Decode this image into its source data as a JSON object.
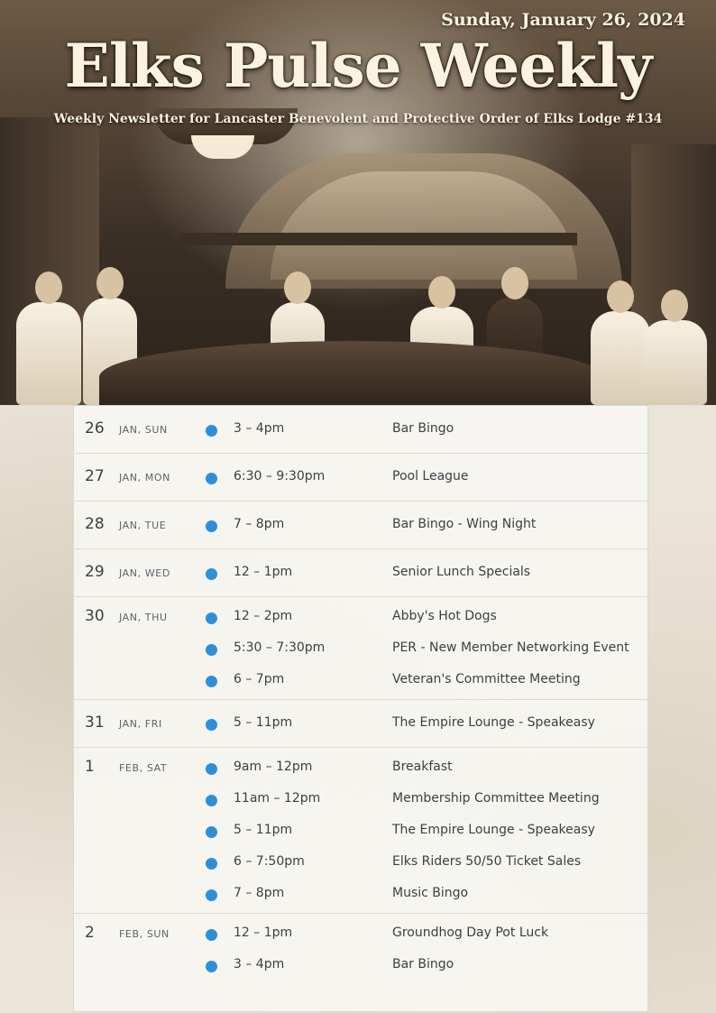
{
  "header": {
    "date": "Sunday, January 26, 2024",
    "title": "Elks Pulse Weekly",
    "subtitle": "Weekly Newsletter for Lancaster Benevolent and Protective Order of Elks Lodge #134"
  },
  "colors": {
    "event_dot": "#2e8fd9",
    "text": "#3c4043",
    "label": "#5f6368"
  },
  "days": [
    {
      "num": "26",
      "label": "JAN, SUN",
      "events": [
        {
          "time": "3 – 4pm",
          "title": "Bar Bingo"
        }
      ]
    },
    {
      "num": "27",
      "label": "JAN, MON",
      "events": [
        {
          "time": "6:30 – 9:30pm",
          "title": "Pool League"
        }
      ]
    },
    {
      "num": "28",
      "label": "JAN, TUE",
      "events": [
        {
          "time": "7 – 8pm",
          "title": "Bar Bingo - Wing Night"
        }
      ]
    },
    {
      "num": "29",
      "label": "JAN, WED",
      "events": [
        {
          "time": "12 – 1pm",
          "title": "Senior Lunch Specials"
        }
      ]
    },
    {
      "num": "30",
      "label": "JAN, THU",
      "events": [
        {
          "time": "12 – 2pm",
          "title": "Abby's Hot Dogs"
        },
        {
          "time": "5:30 – 7:30pm",
          "title": "PER - New Member Networking Event"
        },
        {
          "time": "6 – 7pm",
          "title": "Veteran's Committee Meeting"
        }
      ]
    },
    {
      "num": "31",
      "label": "JAN, FRI",
      "events": [
        {
          "time": "5 – 11pm",
          "title": "The Empire Lounge - Speakeasy"
        }
      ]
    },
    {
      "num": "1",
      "label": "FEB, SAT",
      "events": [
        {
          "time": "9am – 12pm",
          "title": "Breakfast"
        },
        {
          "time": "11am – 12pm",
          "title": "Membership Committee Meeting"
        },
        {
          "time": "5 – 11pm",
          "title": "The Empire Lounge - Speakeasy"
        },
        {
          "time": "6 – 7:50pm",
          "title": "Elks Riders 50/50 Ticket Sales"
        },
        {
          "time": "7 – 8pm",
          "title": "Music Bingo"
        }
      ]
    },
    {
      "num": "2",
      "label": "FEB, SUN",
      "events": [
        {
          "time": "12 – 1pm",
          "title": "Groundhog Day Pot Luck"
        },
        {
          "time": "3 – 4pm",
          "title": "Bar Bingo"
        }
      ]
    }
  ]
}
